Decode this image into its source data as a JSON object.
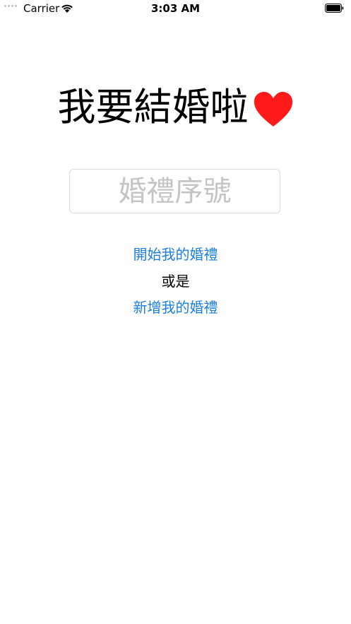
{
  "status_bar": {
    "carrier": "Carrier",
    "time": "3:03 AM"
  },
  "main": {
    "title": "我要結婚啦",
    "heart_icon": "heart-icon",
    "heart_color": "#ff1a1a",
    "wedding_code_input": {
      "value": "",
      "placeholder": "婚禮序號"
    },
    "start_link": "開始我的婚禮",
    "or_text": "或是",
    "create_link": "新增我的婚禮",
    "link_color": "#1a7ee6"
  }
}
